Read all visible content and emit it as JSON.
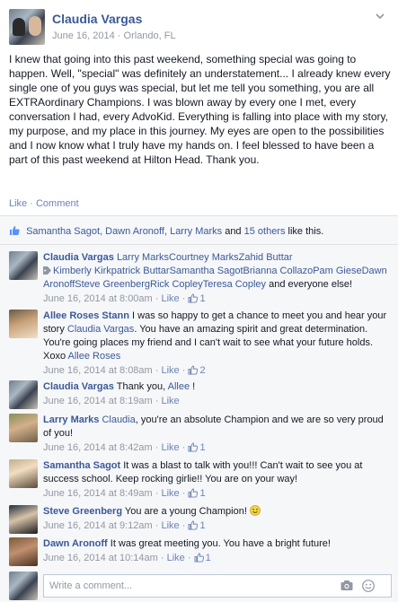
{
  "post": {
    "author": "Claudia Vargas",
    "date": "June 16, 2014",
    "location": "Orlando, FL",
    "separator": "·",
    "body": "I knew that going into this past weekend, something special was going to happen. Well, \"special\" was definitely an understatement... I already knew every single one of you guys was special, but let me tell you something, you are all EXTRAordinary Champions. I was blown away by every one I met, every conversation I had, every AdvoKid. Everything is falling into place with my story, my purpose, and my place in this journey. My eyes are open to the possibilities and I now know what I truly have my hands on. I feel blessed to have been a part of this past weekend at Hilton Head. Thank you.",
    "actions": {
      "like": "Like",
      "dot": "·",
      "comment": "Comment"
    }
  },
  "likes": {
    "names": "Samantha Sagot, Dawn Aronoff, Larry Marks",
    "and": " and ",
    "others": "15 others",
    "suffix": " like this."
  },
  "comments": [
    {
      "author": "Claudia Vargas",
      "tags_line1": "Larry MarksCourtney MarksZahid Buttar",
      "tags_line2": "Kimberly Kirkpatrick ButtarSamantha SagotBrianna CollazoPam GieseDawn AronoffSteve GreenbergRick CopleyTeresa Copley",
      "text_tail": " and everyone else!",
      "time": "June 16, 2014 at 8:00am",
      "like": "Like",
      "likes": "1"
    },
    {
      "author": "Allee Roses Stann",
      "text_a": "I was so happy to get a chance to meet you and hear your story ",
      "mention": "Claudia Vargas",
      "text_b": ". You have an amazing spirit and great determination. You're going places my friend and I can't wait to see what your future holds. Xoxo ",
      "mention2": "Allee Roses",
      "time": "June 16, 2014 at 8:08am",
      "like": "Like",
      "likes": "2"
    },
    {
      "author": "Claudia Vargas",
      "text_a": "Thank you, ",
      "mention": "Allee",
      "text_b": " !",
      "time": "June 16, 2014 at 8:19am",
      "like": "Like"
    },
    {
      "author": "Larry Marks",
      "mention": "Claudia",
      "text_b": ", you're an absolute Champion and we are so very proud of you!",
      "time": "June 16, 2014 at 8:42am",
      "like": "Like",
      "likes": "1"
    },
    {
      "author": "Samantha Sagot",
      "text_a": "It was a blast to talk with you!!! Can't wait to see you at success school. Keep rocking girlie!! You are on your way!",
      "time": "June 16, 2014 at 8:49am",
      "like": "Like",
      "likes": "1"
    },
    {
      "author": "Steve Greenberg",
      "text_a": "You are a young Champion!",
      "time": "June 16, 2014 at 9:12am",
      "like": "Like",
      "likes": "1"
    },
    {
      "author": "Dawn Aronoff",
      "text_a": "It was great meeting you. You have a bright future!",
      "time": "June 16, 2014 at 10:14am",
      "like": "Like",
      "likes": "1"
    }
  ],
  "composer": {
    "placeholder": "Write a comment..."
  },
  "meta_sep": " · ",
  "icons": {
    "chevron": "chevron-down-icon",
    "thumb": "thumbs-up-icon",
    "camera": "camera-icon",
    "smiley": "smiley-icon",
    "tag": "tag-icon"
  },
  "colors": {
    "link": "#3b5998",
    "meta": "#9197a3",
    "background": "#f6f7f9"
  }
}
